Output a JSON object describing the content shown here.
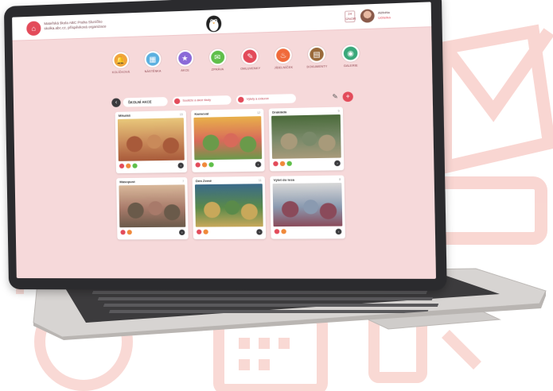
{
  "header": {
    "school_line1": "Mateřská škola ABC Praha Sluníčko",
    "school_line2": "skolka.abc.cz, příspěvková organizace",
    "calendar_badge": "24",
    "calendar_badge_sub": "ÚNOR",
    "user_name": "Alžběta",
    "user_role": "Učitelka"
  },
  "nav": {
    "items": [
      {
        "label": "KOLÍČKOVÁ",
        "color": "#f0a43a",
        "icon": "bell-icon"
      },
      {
        "label": "NÁSTĚNKA",
        "color": "#5ab0e0",
        "icon": "board-icon"
      },
      {
        "label": "AKCE",
        "color": "#8a6ad8",
        "icon": "star-icon"
      },
      {
        "label": "ZPRÁVA",
        "color": "#5fbf4a",
        "icon": "message-icon"
      },
      {
        "label": "OMLUVENKY",
        "color": "#e34b5a",
        "icon": "note-icon"
      },
      {
        "label": "JÍDELNÍČEK",
        "color": "#f06a3a",
        "icon": "food-icon"
      },
      {
        "label": "DOKUMENTY",
        "color": "#9a6a3a",
        "icon": "document-icon"
      },
      {
        "label": "GALERIE",
        "color": "#3aa87a",
        "icon": "gallery-icon"
      }
    ]
  },
  "filters": {
    "main": "ŠKOLNÍ AKCE",
    "chip1": "Soutěže a akce školy",
    "chip2": "Výlety a exkurze"
  },
  "cards": [
    {
      "title": "Mikuláš",
      "meta": "15",
      "palette": [
        "#c98a5a",
        "#e8c77a",
        "#a85a3a"
      ]
    },
    {
      "title": "Karneval",
      "meta": "12",
      "palette": [
        "#d86a5a",
        "#e8b04a",
        "#6a9a4a"
      ]
    },
    {
      "title": "Drakiáda",
      "meta": "9",
      "palette": [
        "#7a8a6a",
        "#4a6a3a",
        "#a89a7a"
      ]
    },
    {
      "title": "Masopust",
      "meta": "7",
      "palette": [
        "#a87a6a",
        "#d8b89a",
        "#6a5a4a"
      ]
    },
    {
      "title": "Den Země",
      "meta": "11",
      "palette": [
        "#5a8a4a",
        "#3a6a8a",
        "#c8a85a"
      ]
    },
    {
      "title": "Výlet do lesa",
      "meta": "8",
      "palette": [
        "#8a9ab0",
        "#d8d8d8",
        "#8a4a5a"
      ]
    }
  ]
}
